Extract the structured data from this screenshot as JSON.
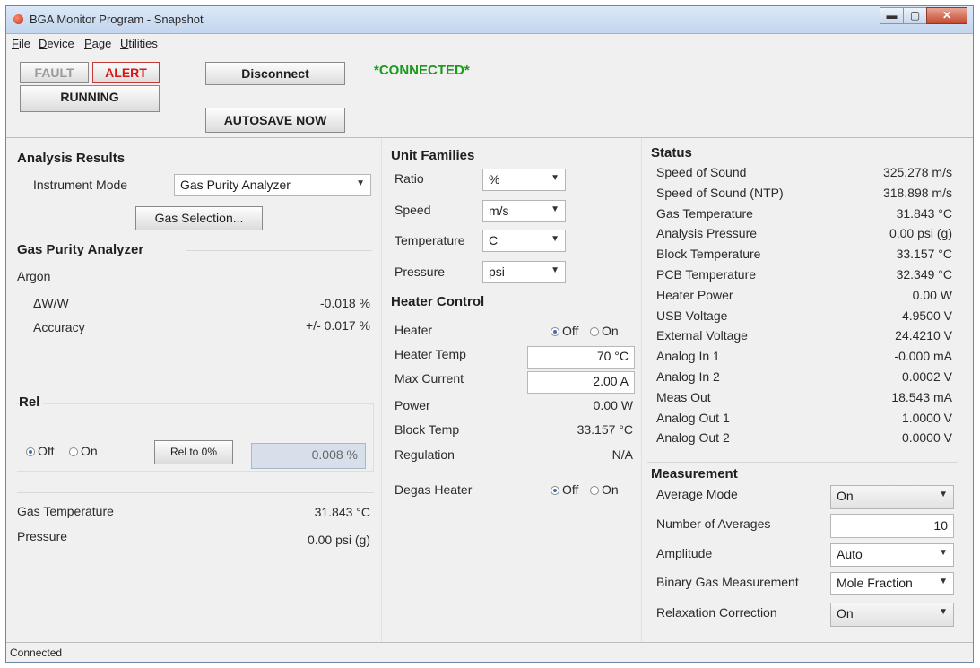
{
  "window": {
    "title": "BGA Monitor Program - Snapshot",
    "controls": [
      "▬",
      "▢",
      "✕"
    ]
  },
  "menu": [
    {
      "mnemonic": "F",
      "rest": "ile"
    },
    {
      "mnemonic": "D",
      "rest": "evice"
    },
    {
      "mnemonic": "P",
      "rest": "age"
    },
    {
      "mnemonic": "U",
      "rest": "tilities"
    }
  ],
  "toolbar": {
    "fault": "FAULT",
    "alert": "ALERT",
    "running": "RUNNING",
    "disconnect": "Disconnect",
    "autosave": "AUTOSAVE NOW",
    "connection_status": "*CONNECTED*"
  },
  "analysis": {
    "title": "Analysis Results",
    "instrument_mode_label": "Instrument Mode",
    "instrument_mode_value": "Gas Purity Analyzer",
    "gas_selection": "Gas Selection..."
  },
  "gpa": {
    "title": "Gas Purity Analyzer",
    "gas": "Argon",
    "dww_label": "ΔW/W",
    "dww_value": "-0.018 %",
    "accuracy_label": "Accuracy",
    "accuracy_value": "+/- 0.017 %"
  },
  "rel": {
    "title": "Rel",
    "off": "Off",
    "on": "On",
    "rel_button": "Rel to 0%",
    "value": "0.008 %"
  },
  "bottom_left": {
    "gas_temp_label": "Gas Temperature",
    "gas_temp_value": "31.843 °C",
    "pressure_label": "Pressure",
    "pressure_value": "0.00 psi (g)"
  },
  "unit_families": {
    "title": "Unit Families",
    "rows": [
      {
        "label": "Ratio",
        "value": "%"
      },
      {
        "label": "Speed",
        "value": "m/s"
      },
      {
        "label": "Temperature",
        "value": "C"
      },
      {
        "label": "Pressure",
        "value": "psi"
      }
    ]
  },
  "heater": {
    "title": "Heater Control",
    "heater_label": "Heater",
    "off": "Off",
    "on": "On",
    "heater_temp_label": "Heater Temp",
    "heater_temp_value": "70 °C",
    "max_current_label": "Max Current",
    "max_current_value": "2.00 A",
    "power_label": "Power",
    "power_value": "0.00 W",
    "block_temp_label": "Block Temp",
    "block_temp_value": "33.157 °C",
    "regulation_label": "Regulation",
    "regulation_value": "N/A",
    "degas_label": "Degas Heater"
  },
  "status": {
    "title": "Status",
    "rows": [
      {
        "label": "Speed of Sound",
        "value": "325.278 m/s"
      },
      {
        "label": "Speed of Sound (NTP)",
        "value": "318.898 m/s"
      },
      {
        "label": "Gas Temperature",
        "value": "31.843 °C"
      },
      {
        "label": "Analysis Pressure",
        "value": "0.00 psi (g)"
      },
      {
        "label": "Block Temperature",
        "value": "33.157 °C"
      },
      {
        "label": "PCB Temperature",
        "value": "32.349 °C"
      },
      {
        "label": "Heater Power",
        "value": "0.00 W"
      },
      {
        "label": "USB Voltage",
        "value": "4.9500 V"
      },
      {
        "label": "External Voltage",
        "value": "24.4210 V"
      },
      {
        "label": "Analog In 1",
        "value": "-0.000 mA"
      },
      {
        "label": "Analog In 2",
        "value": "0.0002 V"
      },
      {
        "label": "Meas Out",
        "value": "18.543 mA"
      },
      {
        "label": "Analog Out 1",
        "value": "1.0000 V"
      },
      {
        "label": "Analog Out 2",
        "value": "0.0000 V"
      }
    ]
  },
  "measurement": {
    "title": "Measurement",
    "average_mode_label": "Average Mode",
    "average_mode_value": "On",
    "num_averages_label": "Number of Averages",
    "num_averages_value": "10",
    "amplitude_label": "Amplitude",
    "amplitude_value": "Auto",
    "binary_label": "Binary Gas Measurement",
    "binary_value": "Mole Fraction",
    "relaxation_label": "Relaxation Correction",
    "relaxation_value": "On"
  },
  "statusbar": {
    "text": "Connected"
  },
  "colors": {
    "connected": "#1a9a1a",
    "alert": "#d11a1a",
    "fault_disabled": "#9a9a9a"
  }
}
